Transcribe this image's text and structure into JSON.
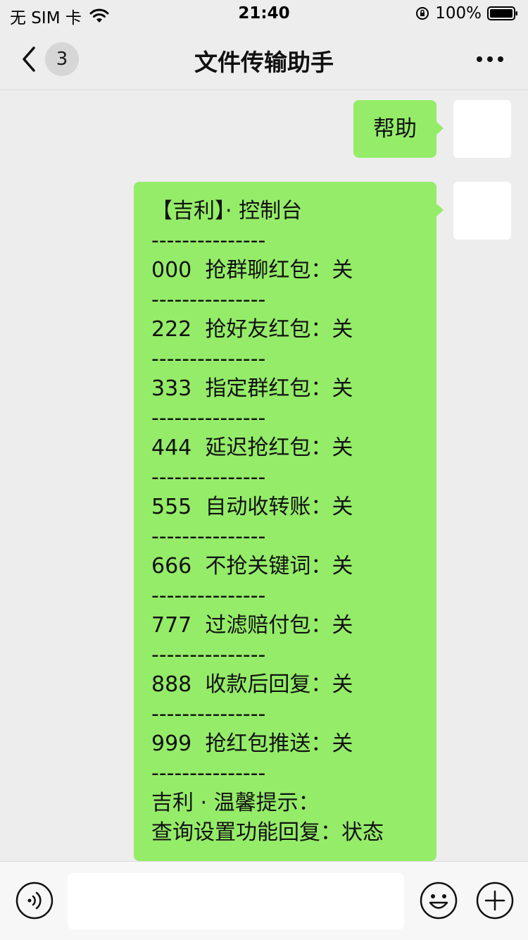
{
  "status_bar": {
    "carrier": "无 SIM 卡",
    "time": "21:40",
    "battery": "100%"
  },
  "nav": {
    "unread_count": "3",
    "title": "文件传输助手"
  },
  "messages": [
    {
      "text": "帮助"
    },
    {
      "lines": [
        "【吉利】· 控制台",
        "---------------",
        "000  抢群聊红包：关",
        "---------------",
        "222  抢好友红包：关",
        "---------------",
        "333  指定群红包：关",
        "---------------",
        "444  延迟抢红包：关",
        "---------------",
        "555  自动收转账：关",
        "---------------",
        "666  不抢关键词：关",
        "---------------",
        "777  过滤赔付包：关",
        "---------------",
        "888  收款后回复：关",
        "---------------",
        "999  抢红包推送：关",
        "---------------",
        "吉利 · 温馨提示：",
        "查询设置功能回复：状态"
      ]
    }
  ],
  "colors": {
    "bubble": "#95ec69",
    "background": "#ededed"
  },
  "icons": [
    "wifi-icon",
    "orientation-lock-icon",
    "battery-icon",
    "back-icon",
    "more-icon",
    "voice-icon",
    "emoji-icon",
    "plus-icon"
  ]
}
